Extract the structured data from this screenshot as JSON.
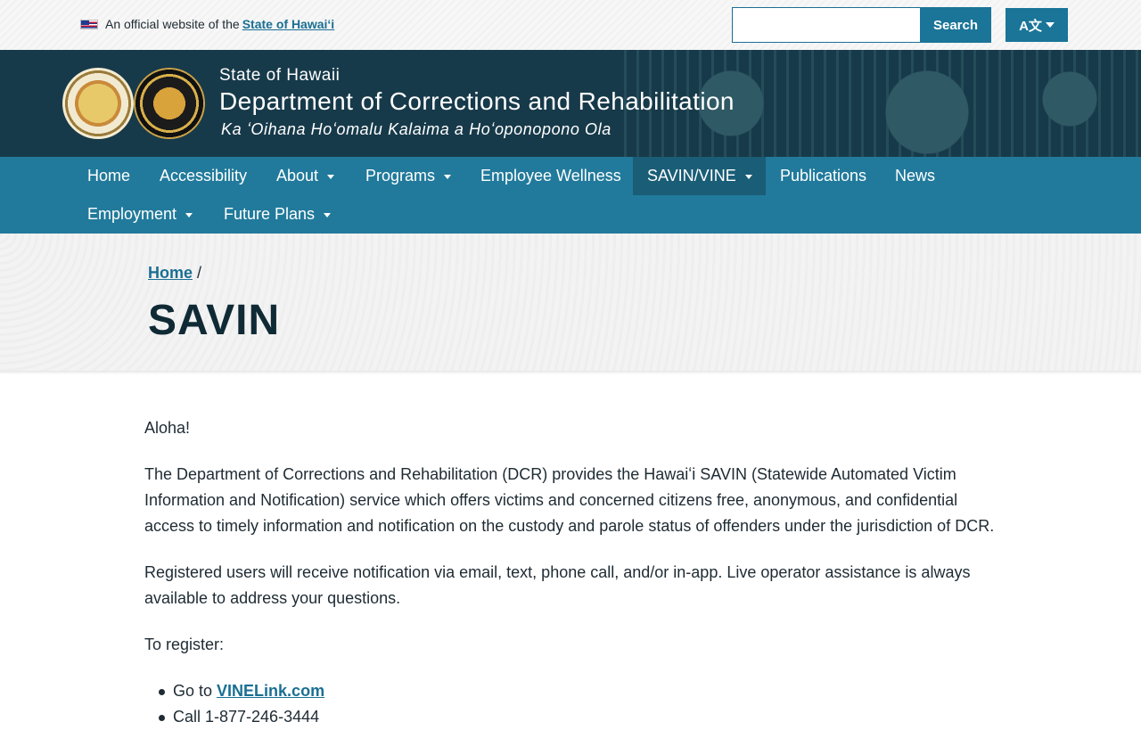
{
  "topbar": {
    "official_prefix": "An official website of the",
    "official_link": "State of Hawaiʻi",
    "search_placeholder": "",
    "search_label": "Search",
    "language_label": "A文"
  },
  "header": {
    "state": "State of Hawaii",
    "department": "Department of Corrections and Rehabilitation",
    "subtitle": "Ka ʻOihana Hoʻomalu Kalaima a Hoʻoponopono Ola"
  },
  "nav": {
    "items": [
      {
        "label": "Home"
      },
      {
        "label": "Accessibility"
      },
      {
        "label": "About"
      },
      {
        "label": "Programs"
      },
      {
        "label": "Employee Wellness"
      },
      {
        "label": "SAVIN/VINE"
      },
      {
        "label": "Publications"
      },
      {
        "label": "News"
      },
      {
        "label": "Employment"
      },
      {
        "label": "Future Plans"
      }
    ]
  },
  "page": {
    "breadcrumb_home": "Home",
    "breadcrumb_sep": "/",
    "title": "SAVIN"
  },
  "content": {
    "greeting": "Aloha!",
    "para1": "The Department of Corrections and Rehabilitation (DCR) provides the Hawaiʻi SAVIN (Statewide Automated Victim Information and Notification) service which offers victims and concerned citizens free, anonymous, and confidential access to timely information and notification on the custody and parole status of offenders under the jurisdiction of DCR.",
    "para2": "Registered users will receive notification via email, text, phone call, and/or in-app. Live operator assistance is always available to address your questions.",
    "register_intro": "To register:",
    "list_item1_prefix": "Go to",
    "list_item1_link": "VINELink.com",
    "list_item2": "Call 1-877-246-3444"
  }
}
